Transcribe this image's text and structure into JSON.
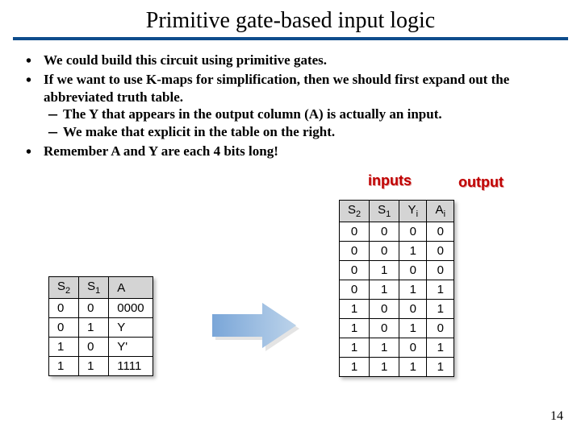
{
  "title": "Primitive gate-based input logic",
  "bullets": {
    "b1": "We could build this circuit using primitive gates.",
    "b2": "If we want to use K-maps for simplification, then we should first expand out the abbreviated truth table.",
    "b2s1": "The Y that appears in the output column (A) is actually an input.",
    "b2s2": "We make that explicit in the table on the right.",
    "b3": "Remember A and Y are each 4 bits long!"
  },
  "labels": {
    "inputs": "inputs",
    "output": "output"
  },
  "left_table": {
    "headers": {
      "c0": "S",
      "c0sub": "2",
      "c1": "S",
      "c1sub": "1",
      "c2": "A"
    },
    "rows": [
      {
        "s2": "0",
        "s1": "0",
        "a": "0000"
      },
      {
        "s2": "0",
        "s1": "1",
        "a": "Y"
      },
      {
        "s2": "1",
        "s1": "0",
        "a": "Y'"
      },
      {
        "s2": "1",
        "s1": "1",
        "a": "1111"
      }
    ]
  },
  "right_table": {
    "headers": {
      "c0": "S",
      "c0sub": "2",
      "c1": "S",
      "c1sub": "1",
      "c2": "Y",
      "c2sub": "i",
      "c3": "A",
      "c3sub": "i"
    },
    "rows": [
      {
        "s2": "0",
        "s1": "0",
        "yi": "0",
        "ai": "0"
      },
      {
        "s2": "0",
        "s1": "0",
        "yi": "1",
        "ai": "0"
      },
      {
        "s2": "0",
        "s1": "1",
        "yi": "0",
        "ai": "0"
      },
      {
        "s2": "0",
        "s1": "1",
        "yi": "1",
        "ai": "1"
      },
      {
        "s2": "1",
        "s1": "0",
        "yi": "0",
        "ai": "1"
      },
      {
        "s2": "1",
        "s1": "0",
        "yi": "1",
        "ai": "0"
      },
      {
        "s2": "1",
        "s1": "1",
        "yi": "0",
        "ai": "1"
      },
      {
        "s2": "1",
        "s1": "1",
        "yi": "1",
        "ai": "1"
      }
    ]
  },
  "page_number": "14"
}
